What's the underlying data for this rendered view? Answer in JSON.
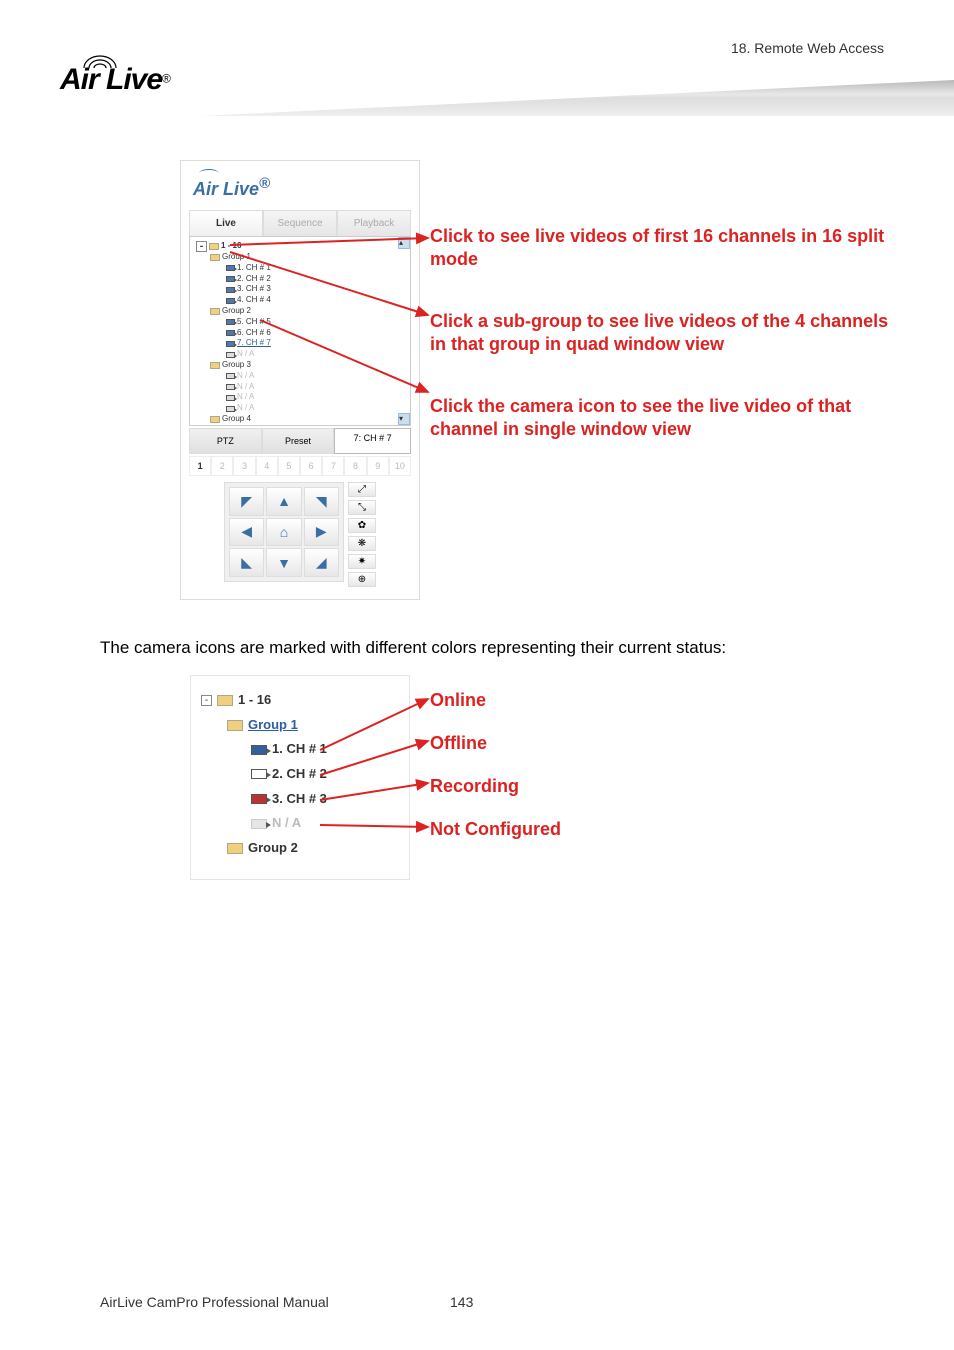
{
  "page": {
    "chapter": "18.  Remote  Web  Access",
    "footer_left": "AirLive  CamPro  Professional  Manual",
    "page_number": "143"
  },
  "logo": {
    "text": "Air Live",
    "reg": "®",
    "panel_text": "Air Live",
    "panel_reg": "®"
  },
  "tabs": {
    "live": "Live",
    "sequence": "Sequence",
    "playback": "Playback"
  },
  "tree": {
    "root": "1 - 16",
    "g1": "Group 1",
    "g1c1": "1. CH # 1",
    "g1c2": "2. CH # 2",
    "g1c3": "3. CH # 3",
    "g1c4": "4. CH # 4",
    "g2": "Group 2",
    "g2c5": "5. CH # 5",
    "g2c6": "6. CH # 6",
    "g2c7": "7. CH # 7",
    "na": "N / A",
    "g3": "Group 3",
    "g4": "Group 4"
  },
  "ptz": {
    "label_ptz": "PTZ",
    "label_preset": "Preset",
    "select_value": "7: CH # 7"
  },
  "numbers": [
    "1",
    "2",
    "3",
    "4",
    "5",
    "6",
    "7",
    "8",
    "9",
    "10"
  ],
  "callouts1": {
    "c1": "Click to see live videos of first 16 channels in 16 split mode",
    "c2": "Click a sub-group to see live videos of the 4 channels in that group in quad window view",
    "c3": "Click the camera icon to see the live video of that channel in single window view"
  },
  "status_para": "The camera icons are marked with different colors representing their current status:",
  "status_tree": {
    "root": "1 - 16",
    "g1": "Group 1",
    "c1": "1. CH # 1",
    "c2": "2. CH # 2",
    "c3": "3. CH # 3",
    "na": "N / A",
    "g2": "Group 2"
  },
  "status_labels": {
    "online": "Online",
    "offline": "Offline",
    "recording": "Recording",
    "not_configured": "Not Configured"
  }
}
